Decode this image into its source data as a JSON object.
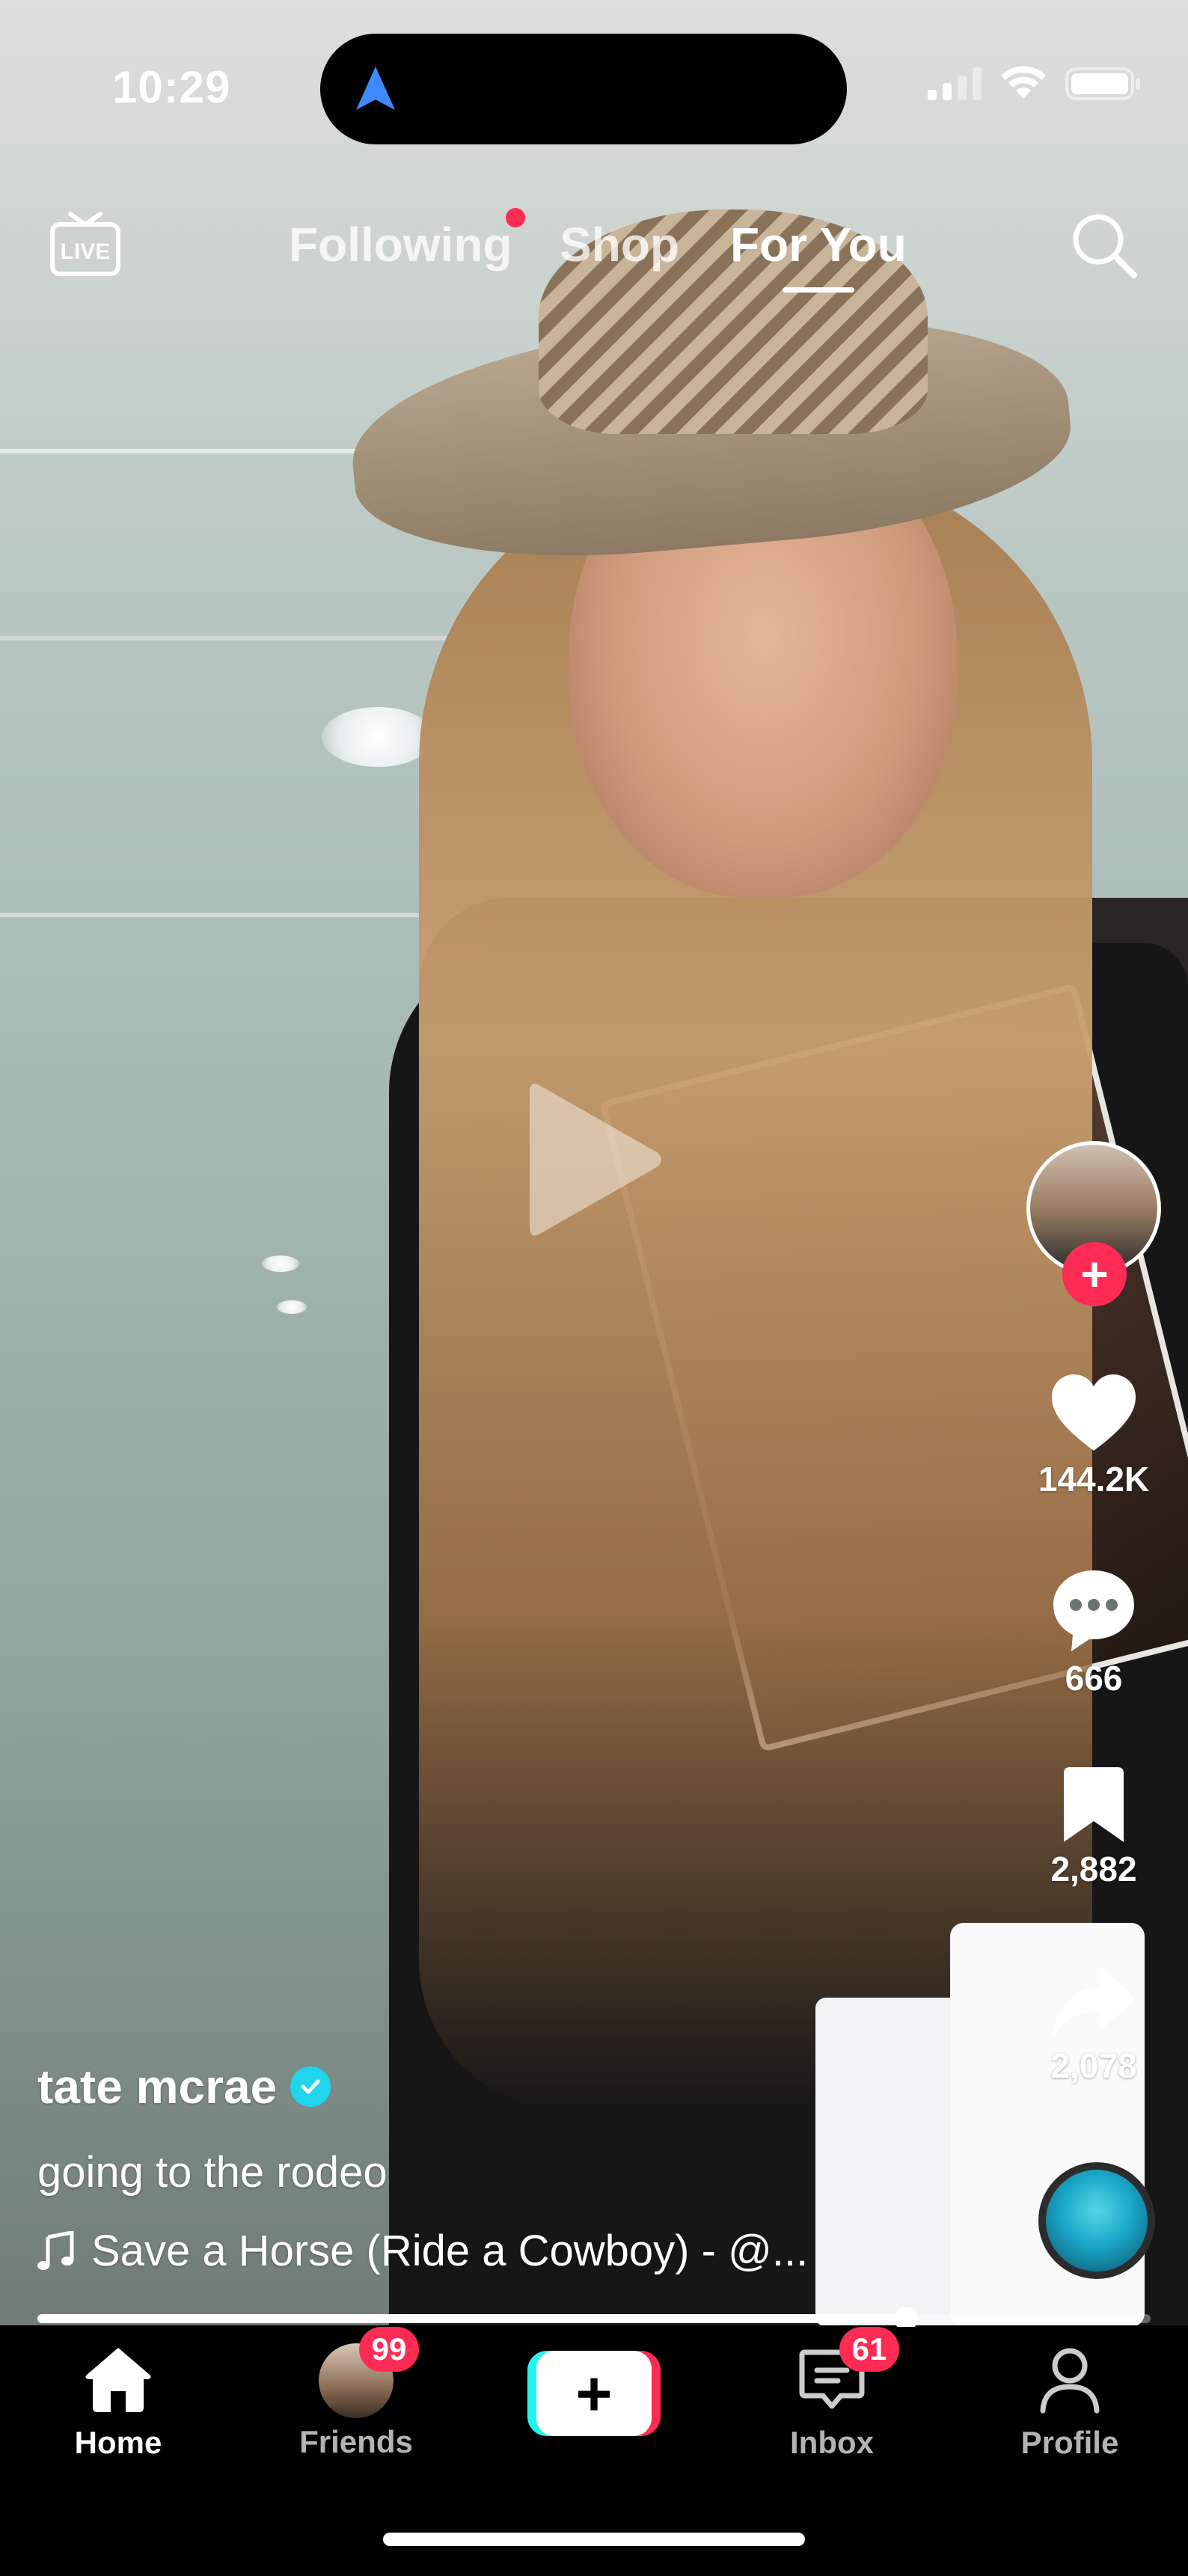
{
  "status_bar": {
    "time": "10:29"
  },
  "top_nav": {
    "live_label": "LIVE",
    "tabs": [
      {
        "label": "Following",
        "has_notification": true
      },
      {
        "label": "Shop"
      },
      {
        "label": "For You",
        "active": true
      }
    ]
  },
  "video": {
    "username": "tate mcrae",
    "verified": true,
    "caption": "going to the rodeo",
    "music": "Save a Horse (Ride a Cowboy) - @...",
    "paused": true,
    "progress": 0.78
  },
  "actions": {
    "likes": "144.2K",
    "comments": "666",
    "saves": "2,882",
    "shares": "2,078"
  },
  "tab_bar": {
    "items": [
      {
        "label": "Home",
        "active": true
      },
      {
        "label": "Friends",
        "badge": "99"
      },
      {
        "label": ""
      },
      {
        "label": "Inbox",
        "badge": "61"
      },
      {
        "label": "Profile"
      }
    ]
  },
  "colors": {
    "accent": "#fe2c55",
    "cyan": "#25f4ee",
    "verified": "#20d5ec"
  }
}
